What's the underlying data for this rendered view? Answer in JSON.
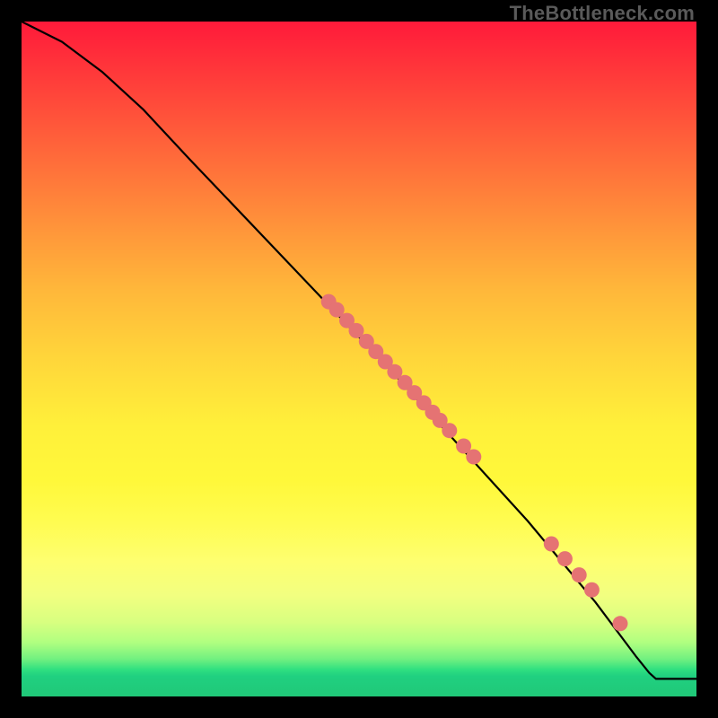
{
  "watermark": "TheBottleneck.com",
  "chart_data": {
    "type": "line",
    "title": "",
    "xlabel": "",
    "ylabel": "",
    "xlim": [
      0,
      100
    ],
    "ylim": [
      0,
      100
    ],
    "grid": false,
    "curve": [
      {
        "x": 0,
        "y": 100
      },
      {
        "x": 6,
        "y": 97
      },
      {
        "x": 12,
        "y": 92.5
      },
      {
        "x": 18,
        "y": 87
      },
      {
        "x": 25,
        "y": 79.5
      },
      {
        "x": 35,
        "y": 69
      },
      {
        "x": 45,
        "y": 58.5
      },
      {
        "x": 55,
        "y": 48
      },
      {
        "x": 65,
        "y": 37
      },
      {
        "x": 75,
        "y": 26
      },
      {
        "x": 85,
        "y": 14
      },
      {
        "x": 91,
        "y": 6
      },
      {
        "x": 93,
        "y": 3.5
      },
      {
        "x": 94,
        "y": 2.6
      },
      {
        "x": 100,
        "y": 2.6
      }
    ],
    "markers": [
      {
        "x": 45.5,
        "y": 58.5
      },
      {
        "x": 46.7,
        "y": 57.3
      },
      {
        "x": 48.2,
        "y": 55.7
      },
      {
        "x": 49.6,
        "y": 54.2
      },
      {
        "x": 51.1,
        "y": 52.6
      },
      {
        "x": 52.5,
        "y": 51.1
      },
      {
        "x": 53.9,
        "y": 49.6
      },
      {
        "x": 55.3,
        "y": 48.1
      },
      {
        "x": 56.8,
        "y": 46.5
      },
      {
        "x": 58.2,
        "y": 45.0
      },
      {
        "x": 59.6,
        "y": 43.5
      },
      {
        "x": 60.9,
        "y": 42.1
      },
      {
        "x": 62.0,
        "y": 40.9
      },
      {
        "x": 63.4,
        "y": 39.4
      },
      {
        "x": 65.5,
        "y": 37.1
      },
      {
        "x": 67.0,
        "y": 35.5
      },
      {
        "x": 78.5,
        "y": 22.6
      },
      {
        "x": 80.5,
        "y": 20.4
      },
      {
        "x": 82.6,
        "y": 18.0
      },
      {
        "x": 84.5,
        "y": 15.8
      },
      {
        "x": 88.7,
        "y": 10.8
      }
    ],
    "colors": {
      "line": "#000000",
      "marker_fill": "#e57373",
      "marker_stroke": "#c05050"
    }
  }
}
